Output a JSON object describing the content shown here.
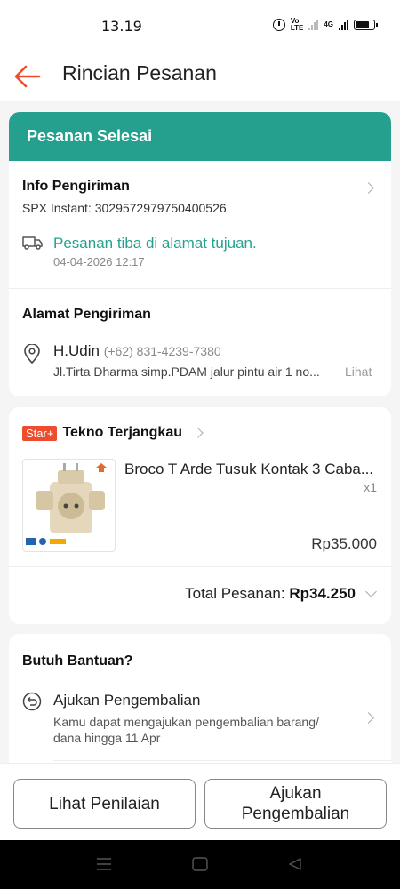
{
  "status_bar": {
    "time": "13.19",
    "volte": "Vo",
    "lte": "LTE",
    "network": "4G"
  },
  "header": {
    "title": "Rincian Pesanan"
  },
  "order_status": {
    "label": "Pesanan Selesai"
  },
  "shipping_info": {
    "title": "Info Pengiriman",
    "tracking": "SPX Instant: 3029572979750400526",
    "status": "Pesanan tiba di alamat tujuan.",
    "timestamp": "04-04-2026 12:17"
  },
  "address": {
    "title": "Alamat Pengiriman",
    "name": "H.Udin",
    "phone": "(+62) 831-4239-7380",
    "line": "Jl.Tirta Dharma simp.PDAM jalur pintu air 1 no...",
    "more_label": "Lihat"
  },
  "shop": {
    "badge": "Star+",
    "name": "Tekno Terjangkau"
  },
  "product": {
    "name": "Broco T Arde Tusuk Kontak 3 Caba...",
    "qty": "x1",
    "price": "Rp35.000"
  },
  "total": {
    "label": "Total Pesanan:",
    "value": "Rp34.250"
  },
  "help": {
    "title": "Butuh Bantuan?",
    "return_title": "Ajukan Pengembalian",
    "return_desc_1": "Kamu dapat mengajukan pengembalian barang/",
    "return_desc_2": "dana hingga 11 Apr"
  },
  "actions": {
    "review_label": "Lihat Penilaian",
    "return_label_1": "Ajukan",
    "return_label_2": "Pengembalian"
  },
  "colors": {
    "accent": "#ee4d2d",
    "banner": "#26a08e",
    "status_text": "#26a08e"
  },
  "icons": [
    "back-arrow-icon",
    "truck-icon",
    "location-pin-icon",
    "chevron-right-icon",
    "chevron-down-icon",
    "return-icon"
  ]
}
